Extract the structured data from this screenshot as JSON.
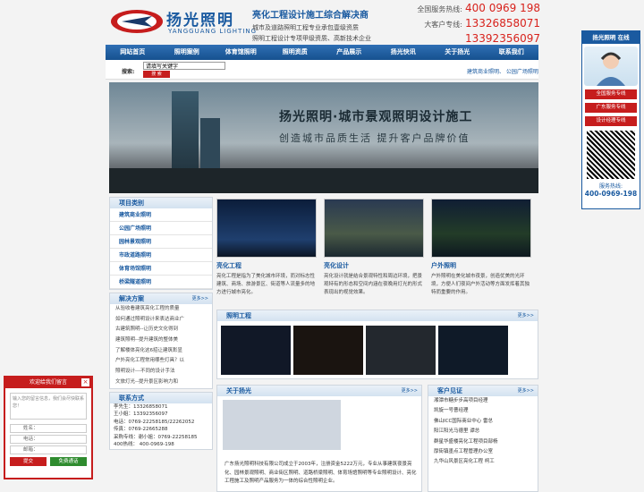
{
  "header": {
    "brand": "扬光照明",
    "brand_en": "YANGGUANG LIGHTING",
    "slogan": "亮化工程设计施工综合解决商",
    "sub1": "城市及道路照明工程专业承包壹级资质",
    "sub2": "照明工程设计专项甲级资质、高新技术企业",
    "hotline_label": "全国服务热线:",
    "hotline": "400 0969 198",
    "vip_label": "大客户专线:",
    "vip1": "13326858071",
    "vip2": "13392356097"
  },
  "nav": [
    "网站首页",
    "照明案例",
    "体育馆照明",
    "照明资质",
    "产品展示",
    "扬光快讯",
    "关于扬光",
    "联系我们"
  ],
  "search": {
    "label": "搜索:",
    "value": "请填写关键字",
    "button": "搜 索",
    "keywords": "建筑商业照明、 公园广场照明"
  },
  "banner": {
    "title": "扬光照明·城市景观照明设计施工",
    "subtitle": "创造城市品质生活 提升客户品牌价值"
  },
  "categories": {
    "title": "项目类别",
    "items": [
      "建筑商业照明",
      "公园广场照明",
      "园林景观照明",
      "市政道路照明",
      "体育场馆照明",
      "桥梁隧道照明"
    ]
  },
  "solutions": {
    "title": "解决方案",
    "more": "更多>>",
    "items": [
      "从验收看建筑亮化工程的质量",
      "如何通过照明设计来表达商业广",
      "古建筑照明--让历史文化得到",
      "建筑照明--提升建筑的整体美",
      "了解楼体亮化这6招让建筑彰显",
      "户外亮化工程常用哪些灯具？以",
      "照明设计---不同的设计手法",
      "文旅灯光--提升景区影响力和"
    ]
  },
  "contact": {
    "title": "联系方式",
    "lines": [
      "李先生：13326858071",
      "王小姐：13392356097",
      "电话：0769-22258185/22262052",
      "传真：0769-22665288",
      "采购专线：谢小姐：0769-22258185",
      "400热线： 400-0969-198"
    ]
  },
  "tiles": [
    {
      "title": "亮化工程",
      "desc": "亮化工程是指为了美化城市环境，而对标志性建筑、商场、旅游景区、街道等人流量多的地方进行城市亮化。"
    },
    {
      "title": "亮化设计",
      "desc": "亮化设计就是结合景观特性和周边环境，把景观特有的形态和空间内涵在夜晚用灯光的形式表现出的视觉效果。"
    },
    {
      "title": "户外照明",
      "desc": "户外照明在美化城市夜景，创造优美的光环境，方便人们夜间户外活动等方面发挥着其独特而重要的作用。"
    }
  ],
  "gallery": {
    "title": "照明工程",
    "more": "更多>>"
  },
  "about": {
    "title": "关于扬光",
    "more": "更多>>",
    "text": "广东扬光照明科技有限公司成立于2003年，注册资金5222万元，专业从事建筑夜景亮化、园林景观照明、商业街区照明、道路桥梁照明、体育场馆照明等专业照明设计、亮化工程施工及照明产品服务为一体的综合性照明企业。"
  },
  "cases": {
    "title": "客户见证",
    "more": "更多>>",
    "items": [
      "湘潭市糖步步高项目经理",
      "凯旋一号曹经理",
      "佛山ICC国际商业中心 雷总",
      "阳江阳光马德里 谭总",
      "群星华盛楼亮化工程项目部杨",
      "厚街镇墨点工程管理办公室",
      "九华山风景区亮化工程 柯工"
    ]
  },
  "service": {
    "title": "扬光照明 在线",
    "btn1": "全国服务专线",
    "btn2": "广东服务专线",
    "btn3": "设计经理专线",
    "label": "服务热线:",
    "number": "400-0969-198"
  },
  "message": {
    "title": "欢迎给我们留言",
    "placeholder": "输入您的留言信息，我们会尽快联系您！",
    "name": "姓名：",
    "phone": "电话：",
    "email": "邮箱：",
    "submit": "提交",
    "call": "免费通话"
  }
}
